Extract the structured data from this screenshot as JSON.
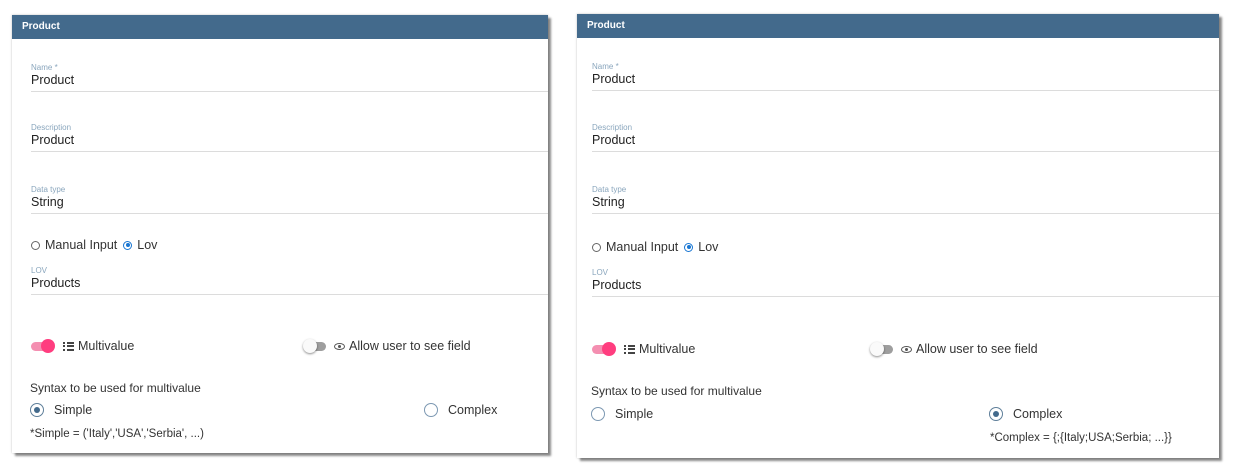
{
  "panels": [
    {
      "header": "Product",
      "name_label": "Name *",
      "name_value": "Product",
      "description_label": "Description",
      "description_value": "Product",
      "datatype_label": "Data type",
      "datatype_value": "String",
      "input_mode": {
        "manual_label": "Manual Input",
        "lov_label": "Lov",
        "selected": "Lov"
      },
      "lov_label": "LOV",
      "lov_value": "Products",
      "multivalue": {
        "label": "Multivalue",
        "on": true
      },
      "allow_user": {
        "label": "Allow user to see field",
        "on": false
      },
      "syntax_title": "Syntax to be used for multivalue",
      "syntax": {
        "simple_label": "Simple",
        "complex_label": "Complex",
        "selected": "Simple"
      },
      "syntax_hint": "*Simple = ('Italy','USA','Serbia', ...)"
    },
    {
      "header": "Product",
      "name_label": "Name *",
      "name_value": "Product",
      "description_label": "Description",
      "description_value": "Product",
      "datatype_label": "Data type",
      "datatype_value": "String",
      "input_mode": {
        "manual_label": "Manual Input",
        "lov_label": "Lov",
        "selected": "Lov"
      },
      "lov_label": "LOV",
      "lov_value": "Products",
      "multivalue": {
        "label": "Multivalue",
        "on": true
      },
      "allow_user": {
        "label": "Allow user to see field",
        "on": false
      },
      "syntax_title": "Syntax to be used for multivalue",
      "syntax": {
        "simple_label": "Simple",
        "complex_label": "Complex",
        "selected": "Complex"
      },
      "syntax_hint": "*Complex = {;{Italy;USA;Serbia; ...}}"
    }
  ],
  "colors": {
    "header": "#436a8c",
    "toggle_on": "#ff3d7f",
    "radio_on": "#1976d2"
  }
}
